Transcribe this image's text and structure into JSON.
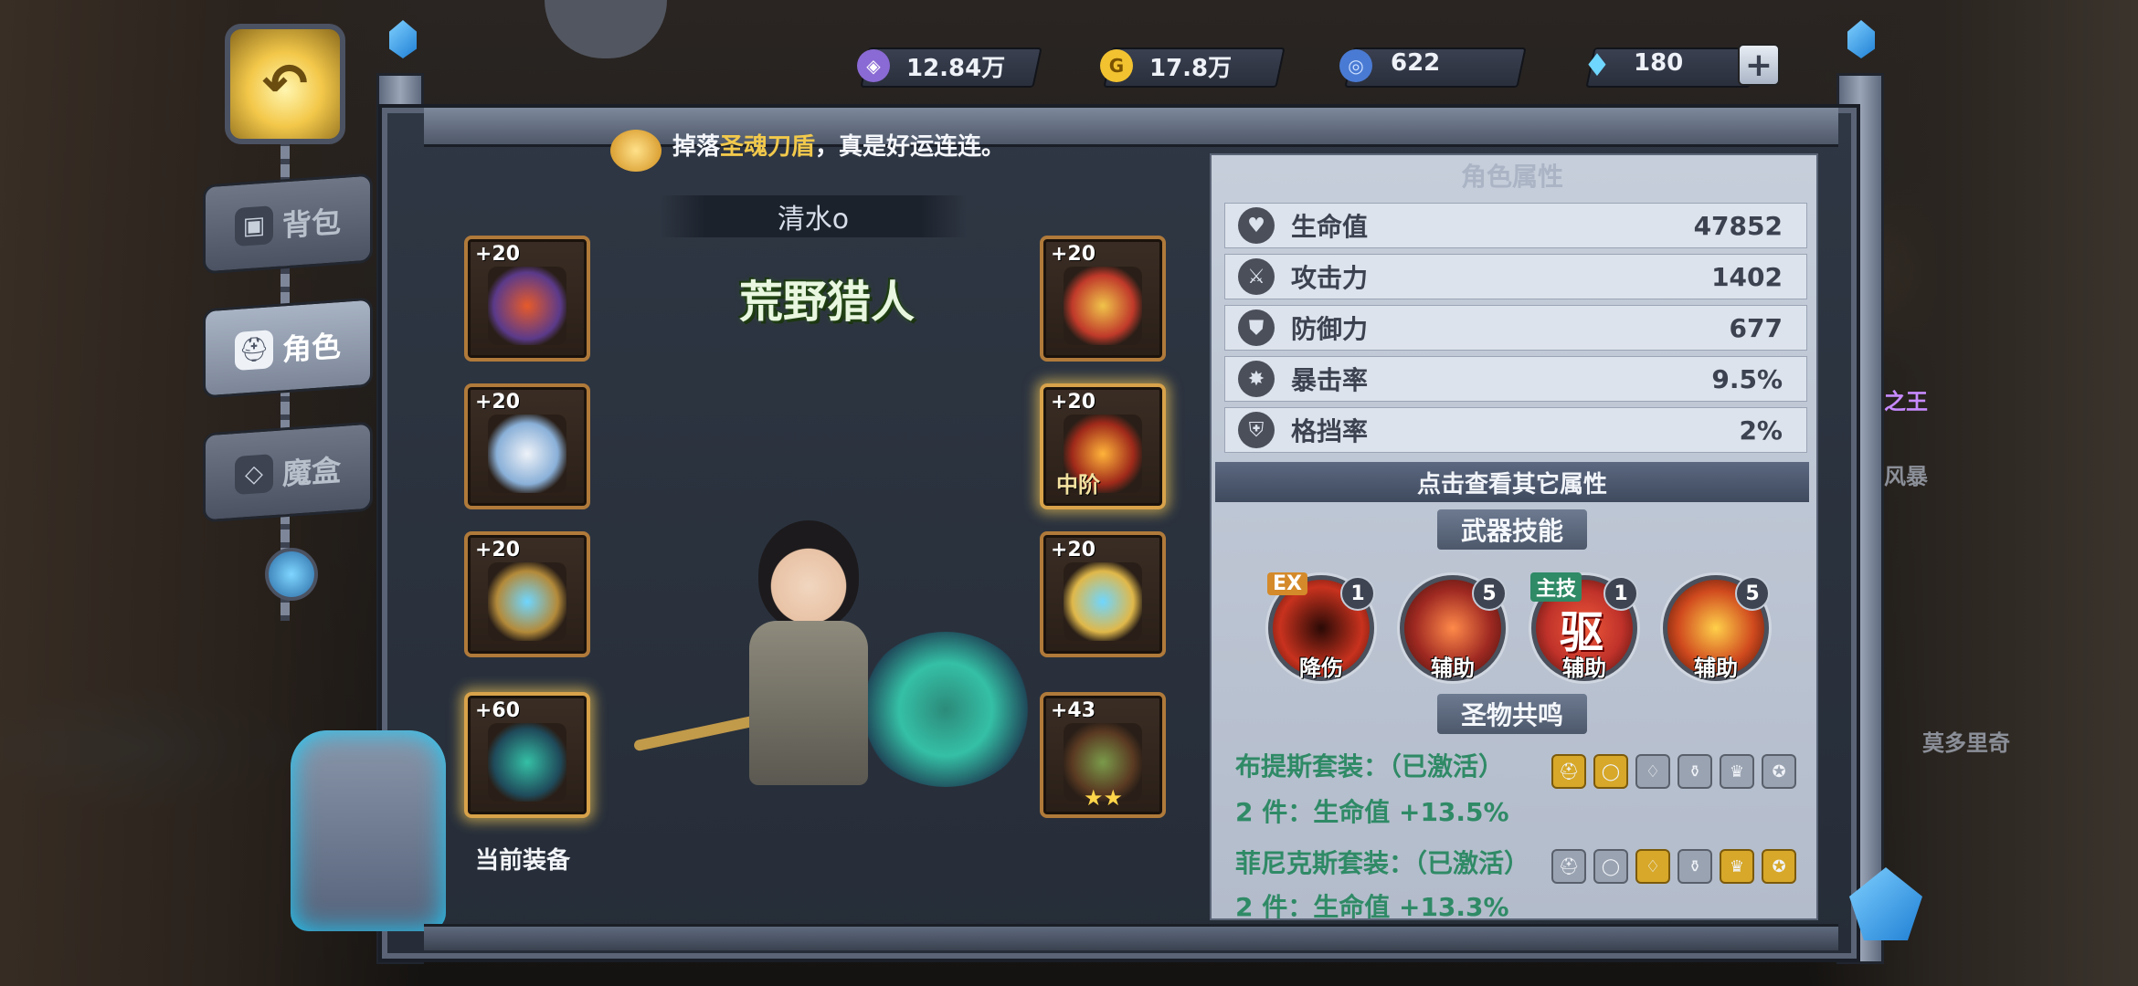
{
  "currencies": [
    {
      "icon": "purple-crystal-icon",
      "value": "12.84万",
      "color": "#8a6ad4"
    },
    {
      "icon": "gold-coin-icon",
      "value": "17.8万",
      "color": "#f2c230"
    },
    {
      "icon": "blue-orb-icon",
      "value": "622",
      "color": "#4a7bd4"
    },
    {
      "icon": "diamond-icon",
      "value": "180",
      "color": "#6fd6ff"
    }
  ],
  "nav": {
    "back_icon": "back-arrow-icon",
    "items": [
      {
        "label": "背包",
        "icon": "backpack-icon",
        "active": false
      },
      {
        "label": "角色",
        "icon": "helmet-icon",
        "active": true
      },
      {
        "label": "魔盒",
        "icon": "magic-box-icon",
        "active": false
      }
    ]
  },
  "notice": {
    "pre": "掉落",
    "highlight": "圣魂刀盾",
    "post": "，真是好运连连。"
  },
  "character": {
    "name": "清水o",
    "title": "荒野猎人",
    "equipped_label": "当前装备"
  },
  "equipment": {
    "left": [
      {
        "level": "+20",
        "item": "helmet",
        "glow": false,
        "tag": ""
      },
      {
        "level": "+20",
        "item": "armor",
        "glow": false,
        "tag": ""
      },
      {
        "level": "+20",
        "item": "staff",
        "glow": false,
        "tag": ""
      },
      {
        "level": "+60",
        "item": "axe",
        "glow": true,
        "tag": ""
      }
    ],
    "right": [
      {
        "level": "+20",
        "item": "ring",
        "glow": false,
        "tag": ""
      },
      {
        "level": "+20",
        "item": "amulet",
        "glow": true,
        "tag": "中阶"
      },
      {
        "level": "+20",
        "item": "scepter",
        "glow": false,
        "tag": ""
      },
      {
        "level": "+43",
        "item": "branch",
        "glow": false,
        "tag": "",
        "stars": "★★"
      }
    ]
  },
  "attributes": {
    "title": "角色属性",
    "rows": [
      {
        "icon": "heart-icon",
        "label": "生命值",
        "value": "47852"
      },
      {
        "icon": "sword-icon",
        "label": "攻击力",
        "value": "1402"
      },
      {
        "icon": "shield-icon",
        "label": "防御力",
        "value": "677"
      },
      {
        "icon": "burst-icon",
        "label": "暴击率",
        "value": "9.5%"
      },
      {
        "icon": "block-icon",
        "label": "格挡率",
        "value": "2%"
      }
    ],
    "more_label": "点击查看其它属性"
  },
  "skills": {
    "title": "武器技能",
    "items": [
      {
        "tag": "EX",
        "level": "1",
        "label": "降伤",
        "color": "#c8321e"
      },
      {
        "tag": "",
        "level": "5",
        "label": "辅助",
        "color": "#a02a22"
      },
      {
        "tag": "主技",
        "level": "1",
        "label": "辅助",
        "glyph": "驱",
        "color": "#c0322a"
      },
      {
        "tag": "",
        "level": "5",
        "label": "辅助",
        "color": "#d04a1e"
      }
    ]
  },
  "relics": {
    "title": "圣物共鸣",
    "sets": [
      {
        "name": "布提斯套装：（已激活）",
        "bonus": "2 件：生命值 +13.5%",
        "icons_on": [
          true,
          true,
          false,
          false,
          false,
          false
        ]
      },
      {
        "name": "菲尼克斯套装：（已激活）",
        "bonus": "2 件：生命值 +13.3%",
        "icons_on": [
          false,
          false,
          true,
          false,
          true,
          true
        ]
      }
    ]
  },
  "side_texts": {
    "king": "之王",
    "storm": "风暴",
    "place": "莫多里奇"
  }
}
